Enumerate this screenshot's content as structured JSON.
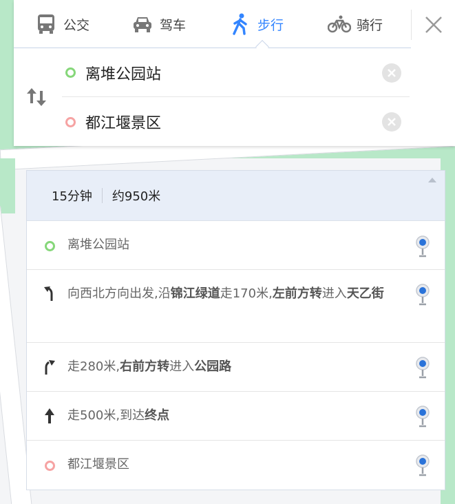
{
  "tabs": [
    {
      "label": "公交",
      "icon": "bus-icon",
      "active": false
    },
    {
      "label": "驾车",
      "icon": "car-icon",
      "active": false
    },
    {
      "label": "步行",
      "icon": "walk-icon",
      "active": true
    },
    {
      "label": "骑行",
      "icon": "bike-icon",
      "active": false
    }
  ],
  "route": {
    "start": "离堆公园站",
    "end": "都江堰景区"
  },
  "summary": {
    "time": "15分钟",
    "distance": "约950米"
  },
  "steps": [
    {
      "type": "start",
      "icon": "start-dot-icon",
      "parts": [
        {
          "t": "离堆公园站",
          "b": false
        }
      ]
    },
    {
      "type": "turn-left",
      "icon": "turn-front-left-icon",
      "parts": [
        {
          "t": "向西北方向出发,沿",
          "b": false
        },
        {
          "t": "锦江绿道",
          "b": true
        },
        {
          "t": "走170米,",
          "b": false
        },
        {
          "t": "左前方转",
          "b": true
        },
        {
          "t": "进入",
          "b": false
        },
        {
          "t": "天乙街",
          "b": true
        }
      ]
    },
    {
      "type": "turn-right",
      "icon": "turn-front-right-icon",
      "parts": [
        {
          "t": "走280米,",
          "b": false
        },
        {
          "t": "右前方转",
          "b": true
        },
        {
          "t": "进入",
          "b": false
        },
        {
          "t": "公园路",
          "b": true
        }
      ]
    },
    {
      "type": "straight",
      "icon": "straight-arrow-icon",
      "parts": [
        {
          "t": "走500米,到达",
          "b": false
        },
        {
          "t": "终点",
          "b": true
        }
      ]
    },
    {
      "type": "end",
      "icon": "end-dot-icon",
      "parts": [
        {
          "t": "都江堰景区",
          "b": false
        }
      ]
    }
  ],
  "colors": {
    "accent": "#3385ff",
    "start_dot": "#86d77a",
    "end_dot": "#f6a3a3",
    "summary_bg": "#e8eef8",
    "map_green": "#b8e8c8"
  }
}
